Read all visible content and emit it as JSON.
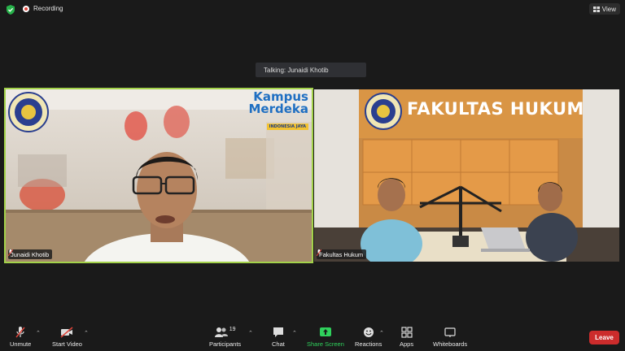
{
  "topbar": {
    "recording_label": "Recording",
    "view_label": "View"
  },
  "talking_banner": "Talking: Junaidi Khotib",
  "tiles": [
    {
      "name": "Junaidi Khotib",
      "logo_text_1": "Kampus",
      "logo_text_2": "Merdeka",
      "logo_text_3": "INDONESIA JAYA",
      "speaking": true
    },
    {
      "name": "Fakultas Hukum",
      "wall_sign": "FAKULTAS HUKUM",
      "speaking": false
    }
  ],
  "toolbar": {
    "unmute": "Unmute",
    "start_video": "Start Video",
    "participants": "Participants",
    "participants_count": "19",
    "chat": "Chat",
    "share_screen": "Share Screen",
    "reactions": "Reactions",
    "apps": "Apps",
    "whiteboards": "Whiteboards",
    "leave": "Leave"
  },
  "colors": {
    "active_speaker_border": "#a3d24a",
    "share_screen": "#2fd15c",
    "leave": "#cc2c2c",
    "recording": "#e0453b"
  }
}
